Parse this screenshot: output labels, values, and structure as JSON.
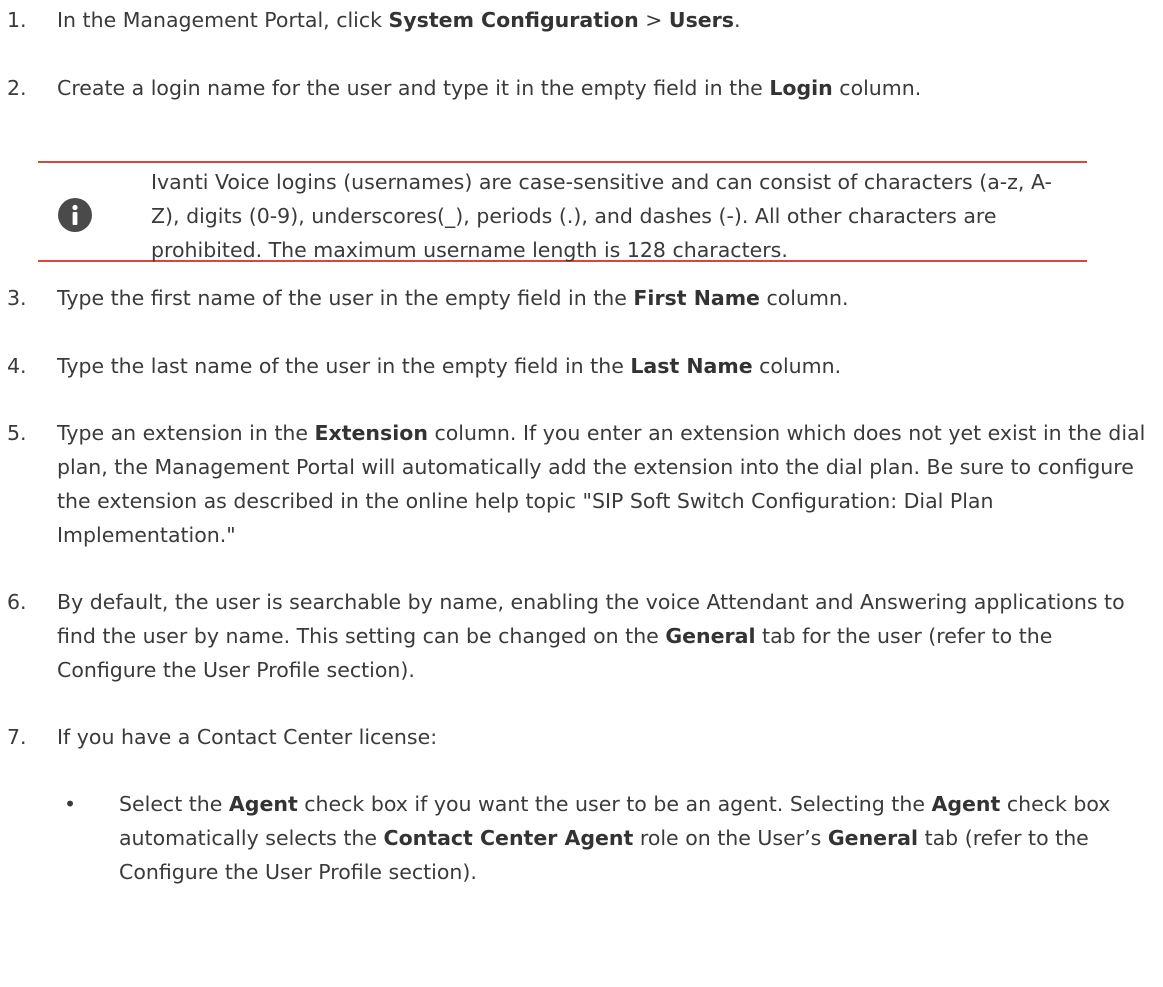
{
  "steps": [
    {
      "num": "1.",
      "parts": [
        {
          "t": "In the Management Portal, click "
        },
        {
          "t": "System Configuration",
          "b": true
        },
        {
          "t": " > "
        },
        {
          "t": "Users",
          "b": true
        },
        {
          "t": "."
        }
      ]
    },
    {
      "num": "2.",
      "parts": [
        {
          "t": "Create a login name for the user and type it in the empty field in the "
        },
        {
          "t": "Login",
          "b": true
        },
        {
          "t": " column."
        }
      ]
    },
    {
      "num": "3.",
      "parts": [
        {
          "t": "Type the first name of the user in the empty field in the "
        },
        {
          "t": "First Name",
          "b": true
        },
        {
          "t": " column."
        }
      ]
    },
    {
      "num": "4.",
      "parts": [
        {
          "t": "Type the last name of the user in the empty field in the "
        },
        {
          "t": "Last Name",
          "b": true
        },
        {
          "t": " column."
        }
      ]
    },
    {
      "num": "5.",
      "parts": [
        {
          "t": "Type an extension in the "
        },
        {
          "t": "Extension",
          "b": true
        },
        {
          "t": " column. If you enter an extension which does not yet exist in the dial plan, the Management Portal will automatically add the extension into the dial plan. Be sure to configure the extension as described in the online help topic \"SIP Soft Switch Configuration: Dial Plan Implementation.\""
        }
      ]
    },
    {
      "num": "6.",
      "parts": [
        {
          "t": "By default, the user is searchable by name, enabling the voice Attendant and Answering applications to find the user by name. This setting can be changed on the "
        },
        {
          "t": "General",
          "b": true
        },
        {
          "t": " tab for the user (refer to the Configure the User Profile section)."
        }
      ]
    },
    {
      "num": "7.",
      "parts": [
        {
          "t": "If you have a Contact Center license:"
        }
      ]
    }
  ],
  "note": {
    "icon": "info-icon",
    "text": "Ivanti Voice logins (usernames) are case-sensitive and can consist of characters (a-z, A-Z), digits (0-9), underscores(_), periods (.), and dashes (-). All other characters are prohibited. The maximum username length is 128 characters.",
    "accent_color": "#d9463a"
  },
  "bullet": {
    "marker": "•",
    "parts": [
      {
        "t": "Select the "
      },
      {
        "t": "Agent",
        "b": true
      },
      {
        "t": " check box if you want the user to be an agent. Selecting the "
      },
      {
        "t": "Agent",
        "b": true
      },
      {
        "t": " check box automatically selects the "
      },
      {
        "t": "Contact Center Agent",
        "b": true
      },
      {
        "t": " role on the User’s "
      },
      {
        "t": "General",
        "b": true
      },
      {
        "t": " tab (refer to the Configure the User Profile section)."
      }
    ]
  }
}
